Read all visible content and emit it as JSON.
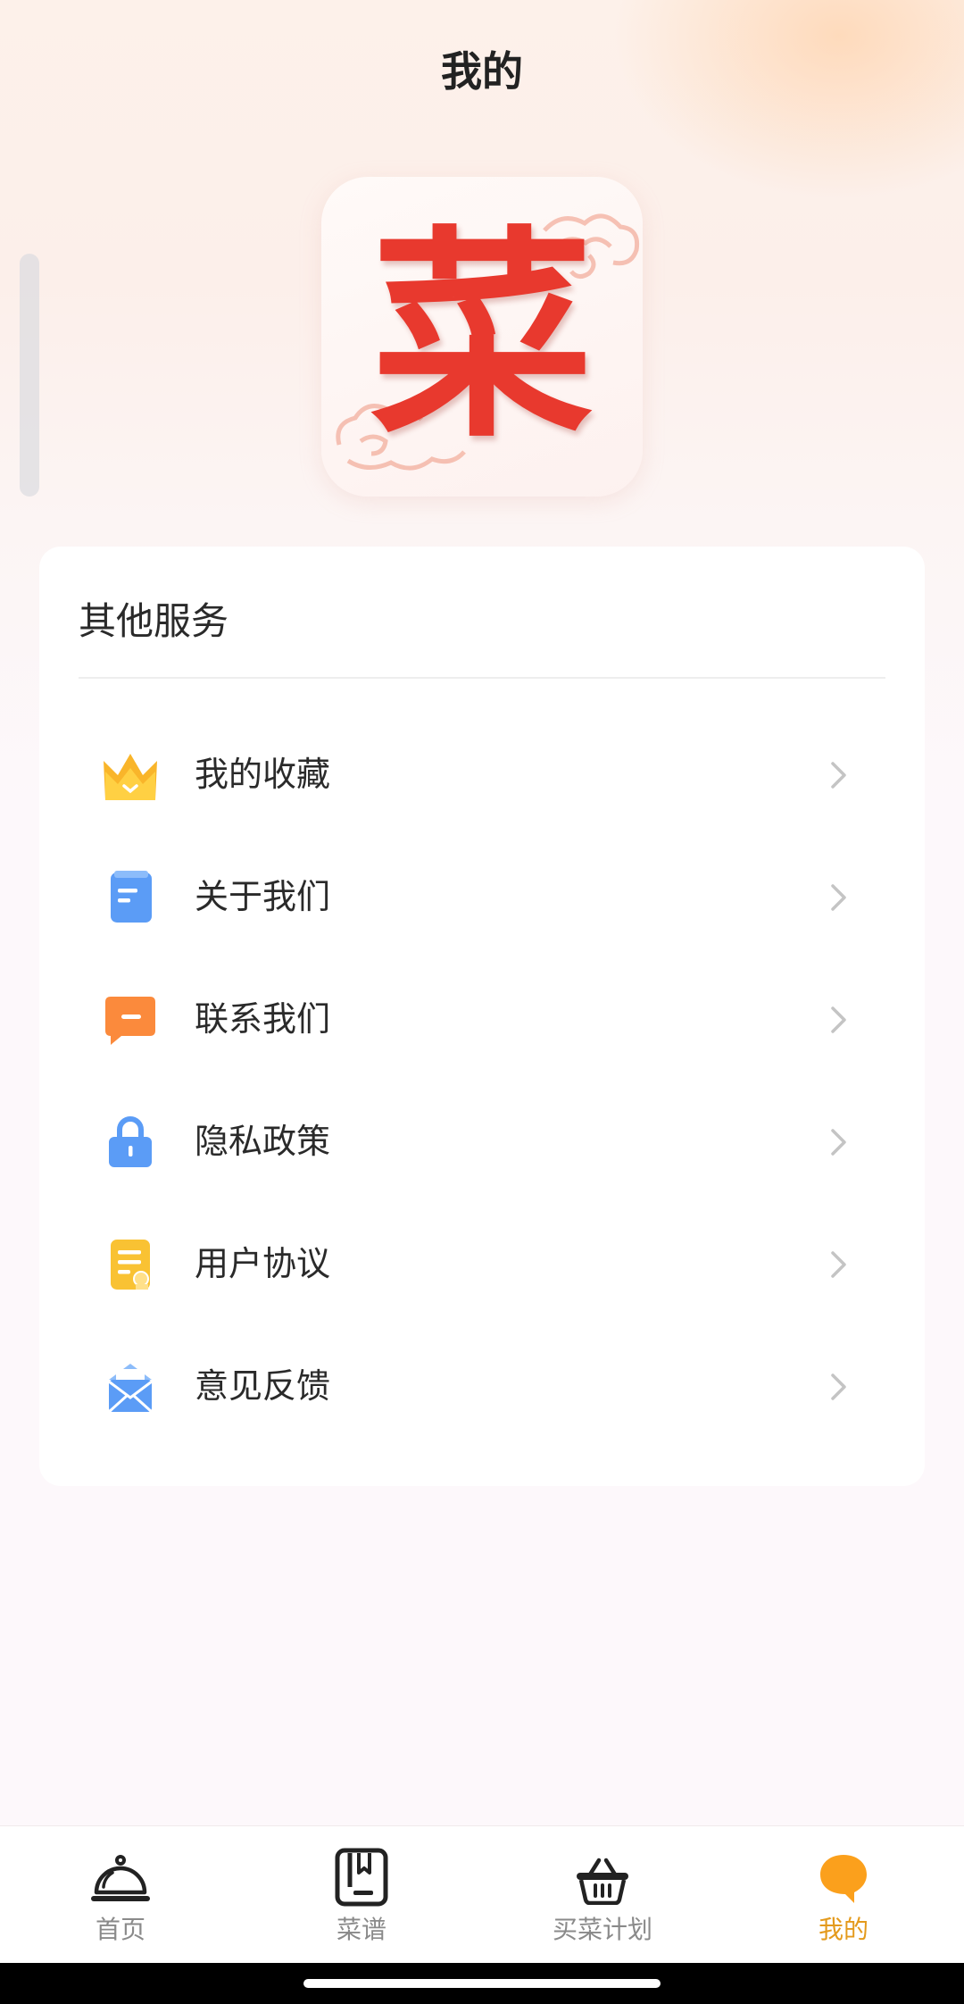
{
  "header": {
    "title": "我的"
  },
  "logo": {
    "char": "菜"
  },
  "services": {
    "title": "其他服务",
    "items": [
      {
        "label": "我的收藏",
        "icon": "crown-icon",
        "color": "#f9b52a"
      },
      {
        "label": "关于我们",
        "icon": "clipboard-icon",
        "color": "#5b9cf6"
      },
      {
        "label": "联系我们",
        "icon": "chat-bubble-icon",
        "color": "#fb8a3c"
      },
      {
        "label": "隐私政策",
        "icon": "lock-icon",
        "color": "#5b9cf6"
      },
      {
        "label": "用户协议",
        "icon": "document-certificate-icon",
        "color": "#f9c233"
      },
      {
        "label": "意见反馈",
        "icon": "mail-icon",
        "color": "#5b9cf6"
      }
    ]
  },
  "tabbar": {
    "tabs": [
      {
        "label": "首页",
        "icon": "cloche-icon",
        "active": false
      },
      {
        "label": "菜谱",
        "icon": "recipe-book-icon",
        "active": false
      },
      {
        "label": "买菜计划",
        "icon": "basket-icon",
        "active": false
      },
      {
        "label": "我的",
        "icon": "profile-bubble-icon",
        "active": true
      }
    ],
    "active_color": "#e49a1c",
    "inactive_color": "#8a8a8a"
  }
}
